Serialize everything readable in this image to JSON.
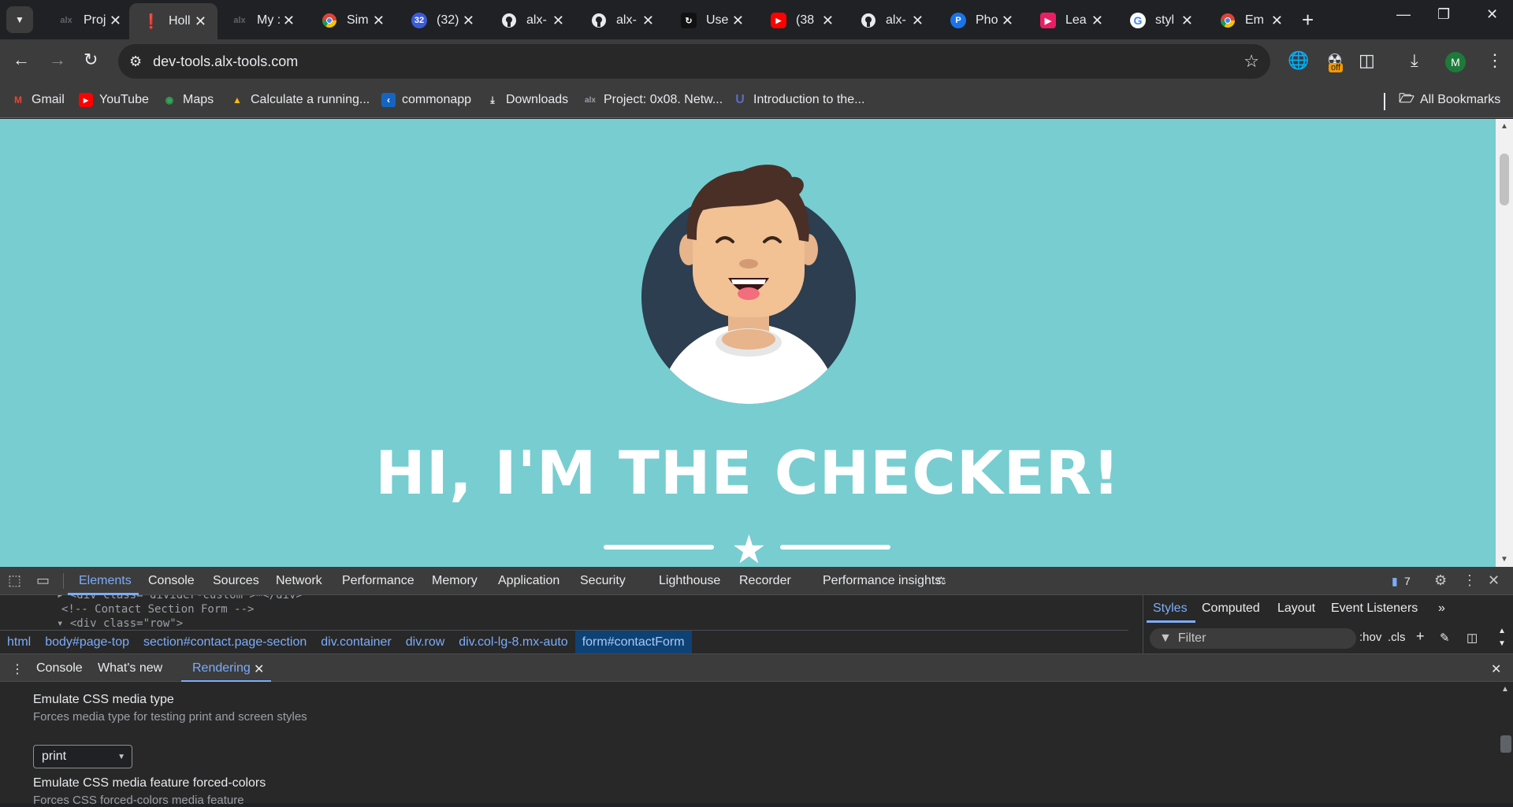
{
  "tabs": [
    {
      "title": "Proj",
      "favicon": "alx-icon",
      "active": false
    },
    {
      "title": "Holl",
      "favicon": "alert-icon",
      "active": true
    },
    {
      "title": "My :",
      "favicon": "alx-icon",
      "active": false
    },
    {
      "title": "Sim",
      "favicon": "chrome-icon",
      "active": false
    },
    {
      "title": "(32)",
      "favicon": "mail-badge-icon",
      "badge": "32",
      "active": false
    },
    {
      "title": "alx-",
      "favicon": "github-icon",
      "active": false
    },
    {
      "title": "alx-",
      "favicon": "github-icon",
      "active": false
    },
    {
      "title": "Use",
      "favicon": "tool-icon",
      "active": false
    },
    {
      "title": "(38",
      "favicon": "youtube-icon",
      "active": false
    },
    {
      "title": "alx-",
      "favicon": "github-icon",
      "active": false
    },
    {
      "title": "Pho",
      "favicon": "photopea-icon",
      "active": false
    },
    {
      "title": "Lea",
      "favicon": "learn-icon",
      "active": false
    },
    {
      "title": "styl",
      "favicon": "google-icon",
      "active": false
    },
    {
      "title": "Em",
      "favicon": "chrome-icon",
      "active": false
    }
  ],
  "address_bar": {
    "url": "dev-tools.alx-tools.com"
  },
  "extension_badge": "off",
  "profile_initial": "M",
  "bookmarks": [
    {
      "label": "Gmail",
      "icon": "gmail-icon"
    },
    {
      "label": "YouTube",
      "icon": "youtube-icon"
    },
    {
      "label": "Maps",
      "icon": "maps-icon"
    },
    {
      "label": "Calculate a running...",
      "icon": "drive-icon"
    },
    {
      "label": "commonapp",
      "icon": "commonapp-icon"
    },
    {
      "label": "Downloads",
      "icon": "download-icon"
    },
    {
      "label": "Project: 0x08. Netw...",
      "icon": "alx-icon"
    },
    {
      "label": "Introduction to the...",
      "icon": "udacity-icon"
    }
  ],
  "all_bookmarks_label": "All Bookmarks",
  "page": {
    "background": "#78cdd1",
    "hero_title": "HI, I'M THE CHECKER!"
  },
  "devtools": {
    "tabs": [
      "Elements",
      "Console",
      "Sources",
      "Network",
      "Performance",
      "Memory",
      "Application",
      "Security",
      "Lighthouse",
      "Recorder",
      "Performance insights"
    ],
    "active_tab": "Elements",
    "issues_count": "7",
    "code_lines": [
      "<!-- Contact Section Form -->"
    ],
    "breadcrumbs": [
      "html",
      "body#page-top",
      "section#contact.page-section",
      "div.container",
      "div.row",
      "div.col-lg-8.mx-auto",
      "form#contactForm"
    ],
    "styles_tabs": [
      "Styles",
      "Computed",
      "Layout",
      "Event Listeners"
    ],
    "filter_placeholder": "Filter",
    "hov_label": ":hov",
    "cls_label": ".cls",
    "drawer_tabs": [
      "Console",
      "What's new",
      "Rendering"
    ],
    "rendering": {
      "media_type_label": "Emulate CSS media type",
      "media_type_desc": "Forces media type for testing print and screen styles",
      "media_type_value": "print",
      "forced_colors_label": "Emulate CSS media feature forced-colors",
      "forced_colors_desc": "Forces CSS forced-colors media feature"
    }
  }
}
